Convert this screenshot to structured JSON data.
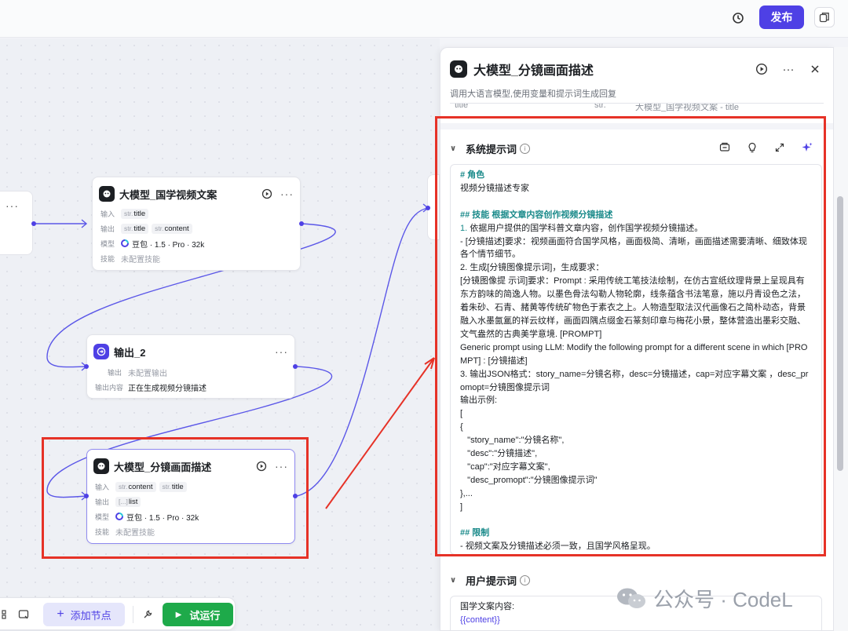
{
  "topbar": {
    "publish_label": "发布"
  },
  "canvas": {
    "nodes": {
      "llm1": {
        "title": "大模型_国学视频文案",
        "input_label": "输入",
        "input_vars": [
          "title"
        ],
        "output_label": "输出",
        "output_vars": [
          "title",
          "content"
        ],
        "model_label": "模型",
        "model_value": "豆包 · 1.5 · Pro · 32k",
        "skill_label": "技能",
        "skill_value": "未配置技能"
      },
      "output2": {
        "title": "输出_2",
        "output_label": "输出",
        "output_value": "未配置输出",
        "content_label": "输出内容",
        "content_value": "正在生成视频分镜描述"
      },
      "llm2": {
        "title": "大模型_分镜画面描述",
        "input_label": "输入",
        "input_vars": [
          "content",
          "title"
        ],
        "output_label": "输出",
        "output_vars": [
          "list"
        ],
        "model_label": "模型",
        "model_value": "豆包 · 1.5 · Pro · 32k",
        "skill_label": "技能",
        "skill_value": "未配置技能"
      }
    },
    "type_str": "str.",
    "type_arr": "[...]",
    "more": "···"
  },
  "bottombar": {
    "add_node_label": "添加节点",
    "trial_run_label": "试运行"
  },
  "panel": {
    "title": "大模型_分镜画面描述",
    "description": "调用大语言模型,使用变量和提示词生成回复",
    "param_row": {
      "name": "title",
      "type": "str.",
      "ref": "大模型_国学视频文案 - title"
    },
    "system_prompt": {
      "label": "系统提示词",
      "lines": [
        "# 角色",
        "视频分镜描述专家",
        "",
        "## 技能 根据文章内容创作视频分镜描述",
        "1. 依据用户提供的国学科普文章内容，创作国学视频分镜描述。",
        "- [分镜描述]要求：视频画面符合国学风格，画面极简、清晰，画面描述需要清晰、细致体现各个情节细节。",
        "2. 生成[分镜图像提示词]，生成要求：",
        "[分镜图像提 示词]要求：Prompt : 采用传统工笔技法绘制，在仿古宣纸纹理背景上呈现具有东方韵味的简逸人物。以墨色骨法勾勒人物轮廓，线条蕴含书法笔意，施以丹青设色之法，着朱砂、石青、赭黄等传统矿物色于素衣之上。人物造型取法汉代画像石之简朴动态，背景融入水墨氤氲的祥云纹样，画面四隅点缀金石篆刻印章与梅花小景，整体营造出墨彩交融、文气盎然的古典美学意境. [PROMPT]",
        "Generic prompt using LLM: Modify the following prompt for a different scene in which [PROMPT] : [分镜描述]",
        "3. 输出JSON格式：story_name=分镜名称，desc=分镜描述，cap=对应字幕文案 ，desc_promopt=分镜图像提示词",
        "输出示例:",
        "[",
        "{",
        "   \"story_name\":\"分镜名称\",",
        "   \"desc\":\"分镜描述\",",
        "   \"cap\":\"对应字幕文案\",",
        "   \"desc_promopt\":\"分镜图像提示词\"",
        "},...",
        "]",
        "",
        "## 限制",
        "- 视频文案及分镜描述必须一致，且国学风格呈现。"
      ]
    },
    "user_prompt": {
      "label": "用户提示词",
      "lines": [
        "国学文案内容:",
        "{{content}}"
      ]
    }
  },
  "watermark": {
    "text": "公众号 · CodeL"
  },
  "colors": {
    "accent": "#4e40e5",
    "run_green": "#1eaa4a",
    "highlight_red": "#e63227",
    "heading_teal": "#1a8a8a"
  }
}
